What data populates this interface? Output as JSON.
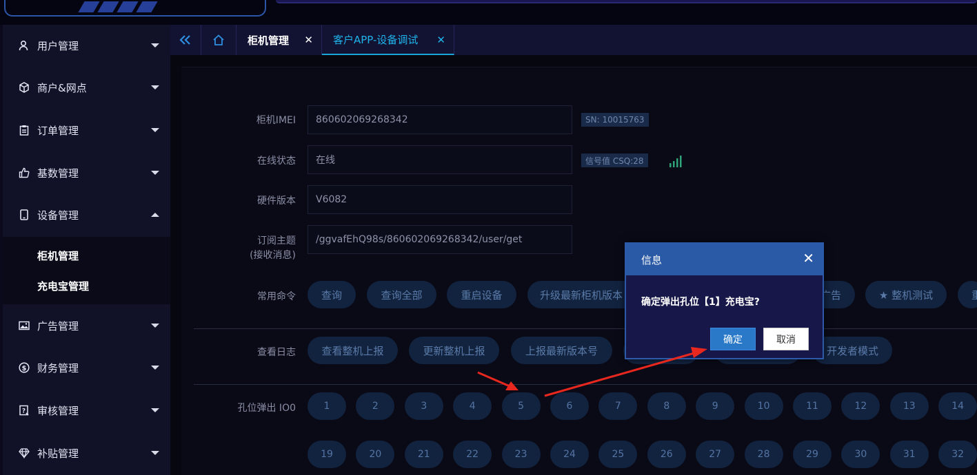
{
  "sidebar": {
    "items": [
      {
        "label": "用户管理",
        "icon": "user-icon"
      },
      {
        "label": "商户&网点",
        "icon": "cube-icon"
      },
      {
        "label": "订单管理",
        "icon": "clipboard-icon"
      },
      {
        "label": "基数管理",
        "icon": "thumbs-up-icon"
      },
      {
        "label": "设备管理",
        "icon": "tablet-icon",
        "expanded": true
      },
      {
        "label": "广告管理",
        "icon": "image-icon"
      },
      {
        "label": "财务管理",
        "icon": "dollar-icon"
      },
      {
        "label": "审核管理",
        "icon": "audit-icon"
      },
      {
        "label": "补贴管理",
        "icon": "diamond-icon"
      }
    ],
    "submenu": [
      "柜机管理",
      "充电宝管理"
    ]
  },
  "tabs": [
    {
      "label": "柜机管理",
      "active": false
    },
    {
      "label": "客户APP-设备调试",
      "active": true
    }
  ],
  "form": {
    "imei": {
      "label": "柜机IMEI",
      "value": "860602069268342",
      "tag": "SN: 10015763"
    },
    "status": {
      "label": "在线状态",
      "value": "在线",
      "tag": "信号值 CSQ:28"
    },
    "hardware": {
      "label": "硬件版本",
      "value": "V6082"
    },
    "topic": {
      "label_line1": "订阅主题",
      "label_line2": "(接收消息)",
      "value": "/ggvafEhQ98s/860602069268342/user/get"
    }
  },
  "commands": {
    "label": "常用命令",
    "buttons": [
      "查询",
      "查询全部",
      "重启设备",
      "升级最新柜机版本",
      "广告",
      "★ 整机测试",
      "重"
    ]
  },
  "logs": {
    "label": "查看日志",
    "buttons": [
      "查看整机上报",
      "更新整机上报",
      "上报最新版本号",
      "开发者模式"
    ]
  },
  "slots": {
    "label": "孔位弹出 IO0",
    "row1": [
      "1",
      "2",
      "3",
      "4",
      "5",
      "6",
      "7",
      "8",
      "9",
      "10",
      "11",
      "12",
      "13",
      "14"
    ],
    "row2": [
      "19",
      "20",
      "21",
      "22",
      "23",
      "24",
      "25",
      "26",
      "27",
      "28",
      "29",
      "30",
      "31",
      "32"
    ]
  },
  "dialog": {
    "title": "信息",
    "message": "确定弹出孔位【1】充电宝?",
    "ok": "确定",
    "cancel": "取消"
  },
  "colors": {
    "accent": "#2a59a6",
    "active_tab": "#1aa6d8",
    "signal": "#2fa37a",
    "annotation_arrow": "#e8281f"
  }
}
